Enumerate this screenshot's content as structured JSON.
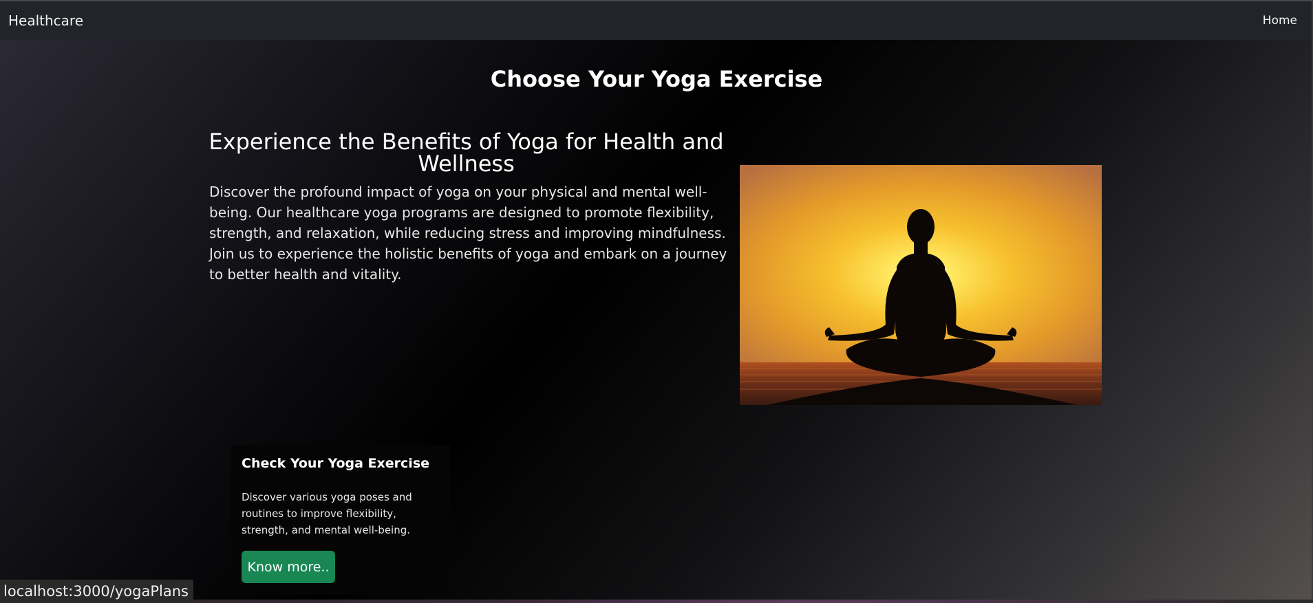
{
  "navbar": {
    "brand": "Healthcare",
    "home_link": "Home"
  },
  "page": {
    "title": "Choose Your Yoga Exercise"
  },
  "hero": {
    "heading": "Experience the Benefits of Yoga for Health and Wellness",
    "text": "Discover the profound impact of yoga on your physical and mental well-being. Our healthcare yoga programs are designed to promote flexibility, strength, and relaxation, while reducing stress and improving mindfulness. Join us to experience the holistic benefits of yoga and embark on a journey to better health and vitality."
  },
  "card": {
    "title": "Check Your Yoga Exercise",
    "text": "Discover various yoga poses and routines to improve flexibility, strength, and mental well-being.",
    "button_label": "Know more.."
  },
  "status_bar": {
    "url": "localhost:3000/yogaPlans"
  },
  "colors": {
    "navbar_bg": "#212529",
    "button_bg": "#198754",
    "card_bg": "#050505"
  }
}
